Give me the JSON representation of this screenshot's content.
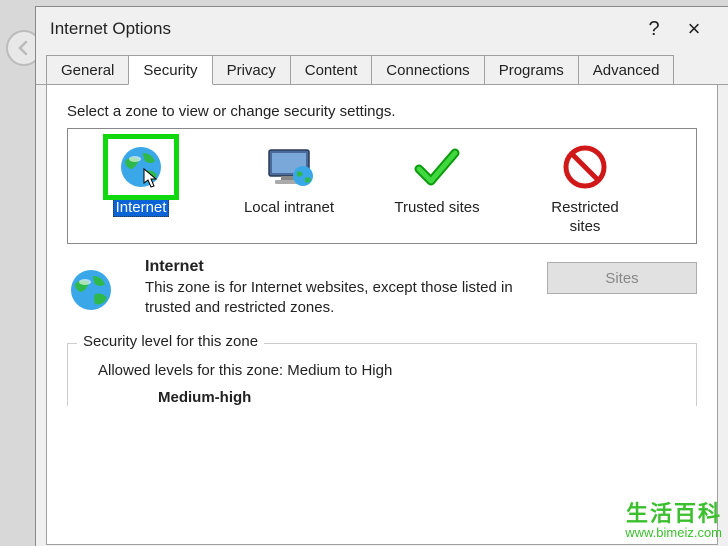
{
  "titlebar": {
    "title": "Internet Options",
    "help": "?",
    "close": "×"
  },
  "tabs": [
    "General",
    "Security",
    "Privacy",
    "Content",
    "Connections",
    "Programs",
    "Advanced"
  ],
  "activeTabIndex": 1,
  "zone_instruction": "Select a zone to view or change security settings.",
  "zones": [
    {
      "label1": "Internet",
      "label2": "",
      "selected": true
    },
    {
      "label1": "Local intranet",
      "label2": "",
      "selected": false
    },
    {
      "label1": "Trusted sites",
      "label2": "",
      "selected": false
    },
    {
      "label1": "Restricted",
      "label2": "sites",
      "selected": false
    }
  ],
  "zone_detail": {
    "title": "Internet",
    "desc": "This zone is for Internet websites, except those listed in trusted and restricted zones."
  },
  "sites_button": "Sites",
  "security_level": {
    "frame_label": "Security level for this zone",
    "allowed": "Allowed levels for this zone: Medium to High",
    "current": "Medium-high"
  },
  "watermark": {
    "cn": "生活百科",
    "url": "www.bimeiz.com"
  }
}
